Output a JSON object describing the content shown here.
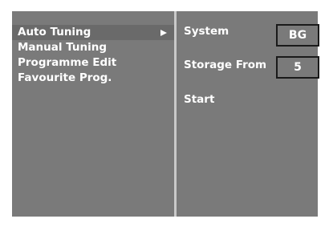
{
  "menu": {
    "items": [
      {
        "label": "Auto Tuning",
        "selected": true
      },
      {
        "label": "Manual Tuning",
        "selected": false
      },
      {
        "label": "Programme Edit",
        "selected": false
      },
      {
        "label": "Favourite Prog.",
        "selected": false
      }
    ],
    "submenu_arrow_icon": "triangle-right-icon"
  },
  "auto_tuning": {
    "system_label": "System",
    "system_value": "BG",
    "storage_label": "Storage From",
    "storage_value": "5",
    "start_label": "Start"
  },
  "colors": {
    "screen_background": "#7a7a7a",
    "selected_highlight": "#6a6a6a",
    "text": "#ffffff",
    "divider": "#c9c9c9",
    "box_border": "#1a1a1a"
  }
}
